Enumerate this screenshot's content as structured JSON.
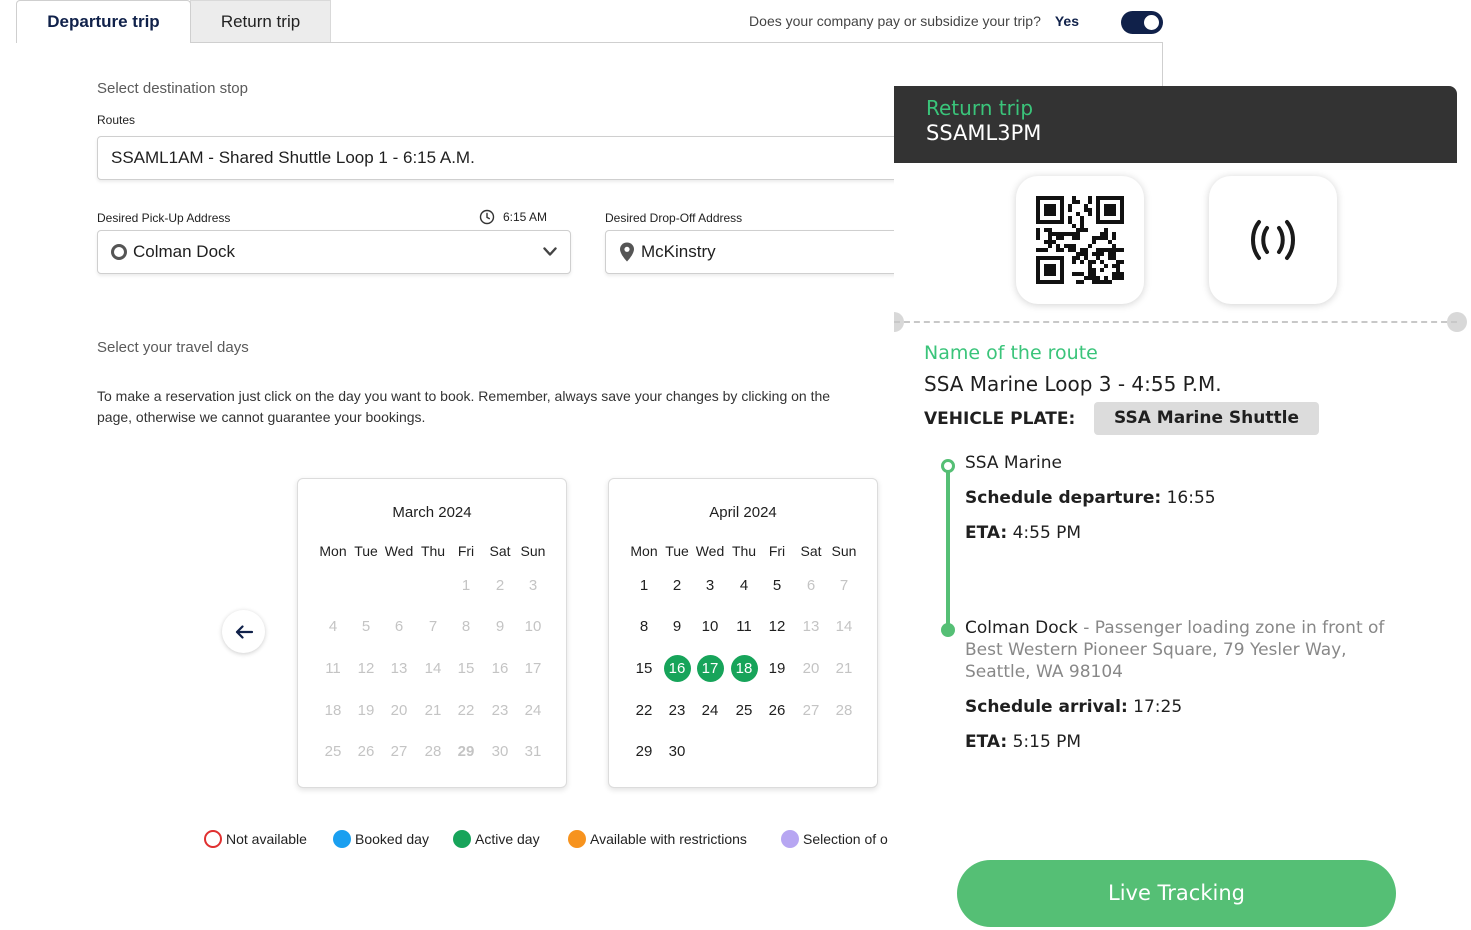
{
  "tabs": {
    "departure": "Departure trip",
    "return": "Return trip"
  },
  "subsidy": {
    "question": "Does your company pay or subsidize your trip?",
    "answer": "Yes",
    "toggle_on": true
  },
  "destination": {
    "section_title": "Select destination stop",
    "routes_label": "Routes",
    "route_value": "SSAML1AM - Shared Shuttle Loop 1 - 6:15 A.M.",
    "pickup_label": "Desired Pick-Up Address",
    "pickup_time": "6:15 AM",
    "pickup_value": "Colman Dock",
    "dropoff_label": "Desired Drop-Off Address",
    "dropoff_value": "McKinstry"
  },
  "travel": {
    "section_title": "Select your travel days",
    "instructions_line1": "To make a reservation just click on the day you want to book. Remember, always save your changes by clicking on the",
    "instructions_line2": "page, otherwise we cannot guarantee your bookings."
  },
  "weekdays": [
    "Mon",
    "Tue",
    "Wed",
    "Thu",
    "Fri",
    "Sat",
    "Sun"
  ],
  "calendars": [
    {
      "title": "March 2024",
      "rows": [
        [
          null,
          null,
          null,
          null,
          {
            "d": "1",
            "s": "muted"
          },
          {
            "d": "2",
            "s": "muted"
          },
          {
            "d": "3",
            "s": "muted"
          }
        ],
        [
          {
            "d": "4",
            "s": "muted"
          },
          {
            "d": "5",
            "s": "muted"
          },
          {
            "d": "6",
            "s": "muted"
          },
          {
            "d": "7",
            "s": "muted"
          },
          {
            "d": "8",
            "s": "muted"
          },
          {
            "d": "9",
            "s": "muted"
          },
          {
            "d": "10",
            "s": "muted"
          }
        ],
        [
          {
            "d": "11",
            "s": "muted"
          },
          {
            "d": "12",
            "s": "muted"
          },
          {
            "d": "13",
            "s": "muted"
          },
          {
            "d": "14",
            "s": "muted"
          },
          {
            "d": "15",
            "s": "muted"
          },
          {
            "d": "16",
            "s": "muted"
          },
          {
            "d": "17",
            "s": "muted"
          }
        ],
        [
          {
            "d": "18",
            "s": "muted"
          },
          {
            "d": "19",
            "s": "muted"
          },
          {
            "d": "20",
            "s": "muted"
          },
          {
            "d": "21",
            "s": "muted"
          },
          {
            "d": "22",
            "s": "muted"
          },
          {
            "d": "23",
            "s": "muted"
          },
          {
            "d": "24",
            "s": "muted"
          }
        ],
        [
          {
            "d": "25",
            "s": "muted"
          },
          {
            "d": "26",
            "s": "muted"
          },
          {
            "d": "27",
            "s": "muted"
          },
          {
            "d": "28",
            "s": "muted"
          },
          {
            "d": "29",
            "s": "muted bold"
          },
          {
            "d": "30",
            "s": "muted"
          },
          {
            "d": "31",
            "s": "muted"
          }
        ]
      ]
    },
    {
      "title": "April 2024",
      "rows": [
        [
          {
            "d": "1",
            "s": ""
          },
          {
            "d": "2",
            "s": ""
          },
          {
            "d": "3",
            "s": ""
          },
          {
            "d": "4",
            "s": ""
          },
          {
            "d": "5",
            "s": ""
          },
          {
            "d": "6",
            "s": "muted"
          },
          {
            "d": "7",
            "s": "muted"
          }
        ],
        [
          {
            "d": "8",
            "s": ""
          },
          {
            "d": "9",
            "s": ""
          },
          {
            "d": "10",
            "s": ""
          },
          {
            "d": "11",
            "s": ""
          },
          {
            "d": "12",
            "s": ""
          },
          {
            "d": "13",
            "s": "muted"
          },
          {
            "d": "14",
            "s": "muted"
          }
        ],
        [
          {
            "d": "15",
            "s": ""
          },
          {
            "d": "16",
            "s": "active"
          },
          {
            "d": "17",
            "s": "active"
          },
          {
            "d": "18",
            "s": "active"
          },
          {
            "d": "19",
            "s": ""
          },
          {
            "d": "20",
            "s": "muted"
          },
          {
            "d": "21",
            "s": "muted"
          }
        ],
        [
          {
            "d": "22",
            "s": ""
          },
          {
            "d": "23",
            "s": ""
          },
          {
            "d": "24",
            "s": ""
          },
          {
            "d": "25",
            "s": ""
          },
          {
            "d": "26",
            "s": ""
          },
          {
            "d": "27",
            "s": "muted"
          },
          {
            "d": "28",
            "s": "muted"
          }
        ],
        [
          {
            "d": "29",
            "s": ""
          },
          {
            "d": "30",
            "s": ""
          },
          null,
          null,
          null,
          null,
          null
        ]
      ]
    }
  ],
  "legend": [
    {
      "label": "Not available",
      "color": "#e03030",
      "ring": true
    },
    {
      "label": "Booked day",
      "color": "#1a9ff0",
      "ring": false
    },
    {
      "label": "Active day",
      "color": "#17a45a",
      "ring": false
    },
    {
      "label": "Available with restrictions",
      "color": "#f7931e",
      "ring": false
    },
    {
      "label": "Selection of o",
      "color": "#b7a6f2",
      "ring": false
    }
  ],
  "ticket": {
    "kind": "Return trip",
    "code": "SSAML3PM",
    "route_heading": "Name of the route",
    "route_name": "SSA Marine Loop 3 - 4:55 P.M.",
    "plate_label": "VEHICLE PLATE:",
    "plate_value": "SSA Marine Shuttle",
    "origin_name": "SSA Marine",
    "departure_label": "Schedule departure:",
    "departure_value": "16:55",
    "eta_label": "ETA:",
    "origin_eta": "4:55 PM",
    "dest_name": "Colman Dock",
    "dest_desc_line1": " - Passenger loading zone in front of",
    "dest_desc_line2": "Best Western Pioneer Square, 79 Yesler Way,",
    "dest_desc_line3": "Seattle, WA 98104",
    "arrival_label": "Schedule arrival:",
    "arrival_value": "17:25",
    "dest_eta": "5:15 PM",
    "live_tracking": "Live Tracking"
  },
  "colors": {
    "navy": "#10214a",
    "green": "#17a45a",
    "ticket_green": "#3ac47a",
    "button_green": "#55bf75",
    "header_dark": "#333333"
  }
}
